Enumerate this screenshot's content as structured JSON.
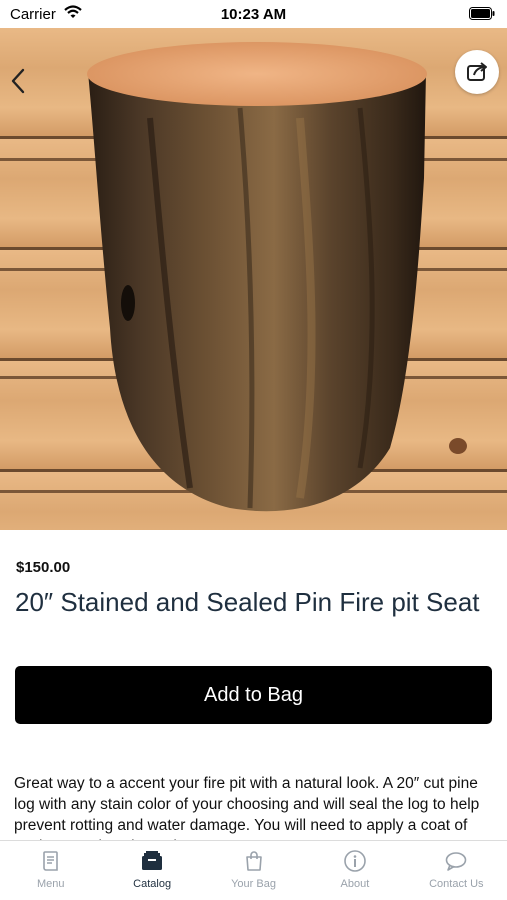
{
  "status_bar": {
    "carrier": "Carrier",
    "time": "10:23 AM"
  },
  "product": {
    "price": "$150.00",
    "title": "20″ Stained and Sealed Pin Fire pit Seat",
    "add_button_label": "Add to Bag",
    "description": "Great way to a accent your fire pit with a natural look. A 20″ cut pine log with any stain color of your choosing and will seal the log to help prevent rotting and water damage. You will need to apply a coat of sealant yearly to keep the seat"
  },
  "tabs": [
    {
      "label": "Menu",
      "icon": "book-icon",
      "active": false
    },
    {
      "label": "Catalog",
      "icon": "catalog-icon",
      "active": true
    },
    {
      "label": "Your Bag",
      "icon": "bag-icon",
      "active": false
    },
    {
      "label": "About",
      "icon": "info-icon",
      "active": false
    },
    {
      "label": "Contact Us",
      "icon": "chat-icon",
      "active": false
    }
  ],
  "colors": {
    "title_text": "#1f2f3f",
    "button_bg": "#000000",
    "tab_inactive": "#9aa2ab"
  }
}
